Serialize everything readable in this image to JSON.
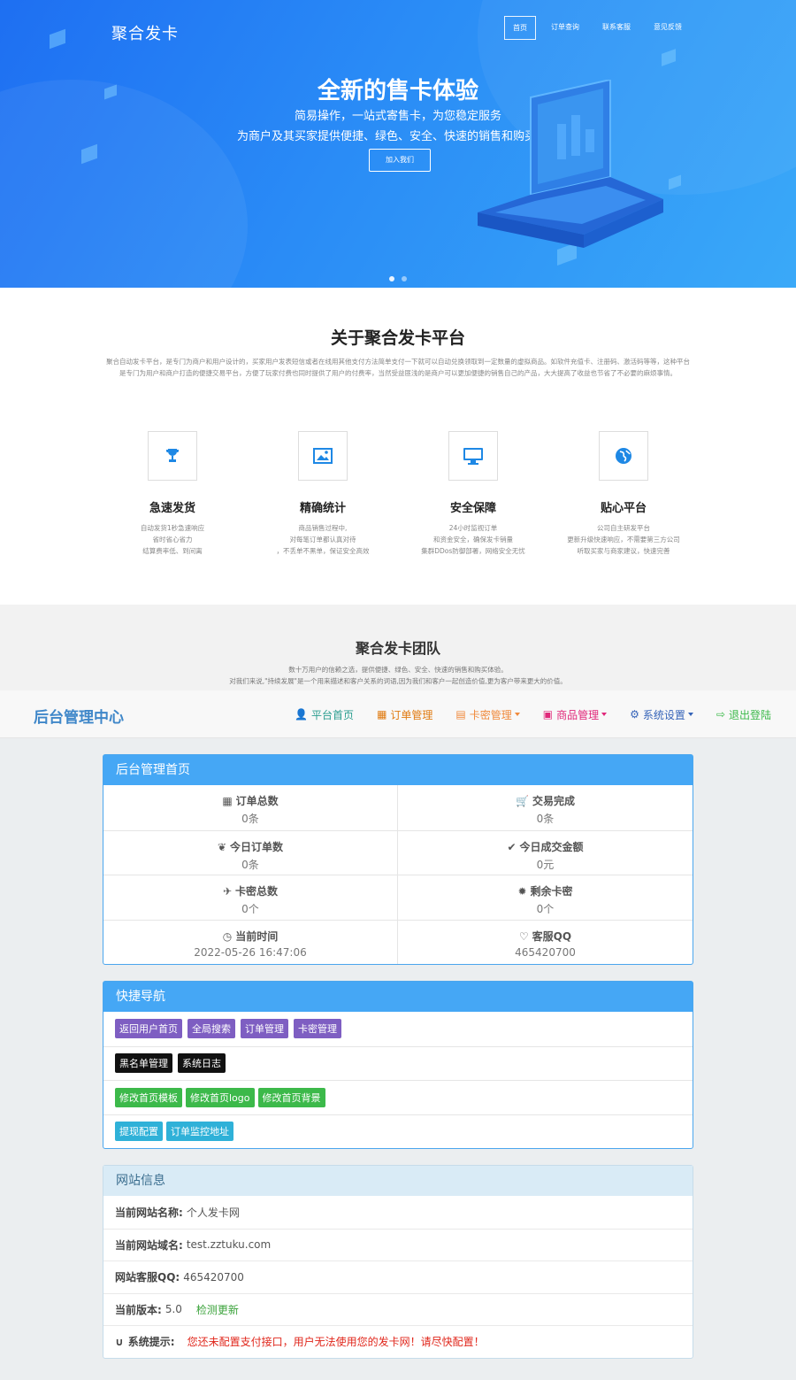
{
  "hero": {
    "logo": "聚合发卡",
    "nav": [
      "首页",
      "订单查询",
      "联系客服",
      "意见反馈"
    ],
    "title": "全新的售卡体验",
    "subtitle1": "简易操作，一站式寄售卡，为您稳定服务",
    "subtitle2": "为商户及其买家提供便捷、绿色、安全、快速的销售和购买体验",
    "button": "加入我们"
  },
  "about": {
    "title": "关于聚合发卡平台",
    "text": "聚合自动发卡平台，是专门为商户和用户设计的，买家用户发表短信或者在线用其他支付方法简单支付一下就可以自动兑换领取到一定数量的虚拟商品。如软件充值卡、注册码、激活码等等，这种平台是专门为用户和商户打造的便捷交易平台，方便了玩家付费也同时提供了用户的付费率，当然受益匪浅的是商户可以更加便捷的销售自己的产品，大大提高了收益也节省了不必要的麻烦事情。",
    "features": [
      {
        "icon": "trophy-icon",
        "title": "急速发货",
        "lines": [
          "自动发货1秒急速响应",
          "省时省心省力",
          "结算费率低、到间离"
        ]
      },
      {
        "icon": "image-icon",
        "title": "精确统计",
        "lines": [
          "商品销售过程中,",
          "对每笔订单都认真对待",
          "，不丢单不黑单，保证安全高效"
        ]
      },
      {
        "icon": "monitor-icon",
        "title": "安全保障",
        "lines": [
          "24小时监视订单",
          "和资金安全，确保发卡销量",
          "集群DDos防御部署，网络安全无忧"
        ]
      },
      {
        "icon": "globe-icon",
        "title": "贴心平台",
        "lines": [
          "公司自主研发平台",
          "更新升级快速响应，不需要第三方公司",
          "听取买家与商家建议，快速完善"
        ]
      }
    ]
  },
  "team": {
    "title": "聚合发卡团队",
    "line1": "数十万用户的信赖之选，提供便捷、绿色、安全、快速的销售和购买体验。",
    "line2": "对我们来说,\"持续发展\"是一个用来描述和客户关系的词语,因为我们和客户一起创造价值,更为客户带来更大的价值。"
  },
  "admin": {
    "brand": "后台管理中心",
    "nav": [
      {
        "icon": "user-icon",
        "label": "平台首页",
        "color": "#2a9d8f",
        "caret": false
      },
      {
        "icon": "calendar-icon",
        "label": "订单管理",
        "color": "#e07b12",
        "caret": false
      },
      {
        "icon": "file-icon",
        "label": "卡密管理",
        "color": "#f08a3c",
        "caret": true
      },
      {
        "icon": "list-icon",
        "label": "商品管理",
        "color": "#e0287a",
        "caret": true
      },
      {
        "icon": "gear-icon",
        "label": "系统设置",
        "color": "#3563b8",
        "caret": true
      },
      {
        "icon": "logout-icon",
        "label": "退出登陆",
        "color": "#3cb94a",
        "caret": false
      }
    ],
    "overview": {
      "title": "后台管理首页",
      "stats": [
        {
          "icon": "grid-icon",
          "label": "订单总数",
          "value": "0条"
        },
        {
          "icon": "cart-icon",
          "label": "交易完成",
          "value": "0条"
        },
        {
          "icon": "leaf-icon",
          "label": "今日订单数",
          "value": "0条"
        },
        {
          "icon": "check-icon",
          "label": "今日成交金额",
          "value": "0元"
        },
        {
          "icon": "plane-icon",
          "label": "卡密总数",
          "value": "0个"
        },
        {
          "icon": "gear-icon",
          "label": "剩余卡密",
          "value": "0个"
        },
        {
          "icon": "clock-icon",
          "label": "当前时间",
          "value": "2022-05-26 16:47:06"
        },
        {
          "icon": "heart-icon",
          "label": "客服QQ",
          "value": "465420700"
        }
      ]
    },
    "quicknav": {
      "title": "快捷导航",
      "rows": [
        {
          "style": "purple",
          "items": [
            "返回用户首页",
            "全局搜索",
            "订单管理",
            "卡密管理"
          ]
        },
        {
          "style": "black",
          "items": [
            "黑名单管理",
            "系统日志"
          ]
        },
        {
          "style": "green",
          "items": [
            "修改首页模板",
            "修改首页logo",
            "修改首页背景"
          ]
        },
        {
          "style": "cyan",
          "items": [
            "提现配置",
            "订单监控地址"
          ]
        }
      ]
    },
    "siteinfo": {
      "title": "网站信息",
      "name_label": "当前网站名称:",
      "name_value": "个人发卡网",
      "domain_label": "当前网站域名:",
      "domain_value": "test.zztuku.com",
      "qq_label": "网站客服QQ:",
      "qq_value": "465420700",
      "version_label": "当前版本:",
      "version_value": "5.0",
      "update_link": "检测更新",
      "notice_label": "系统提示:",
      "notice_text": "您还未配置支付接口，用户无法使用您的发卡网！请尽快配置！"
    }
  }
}
